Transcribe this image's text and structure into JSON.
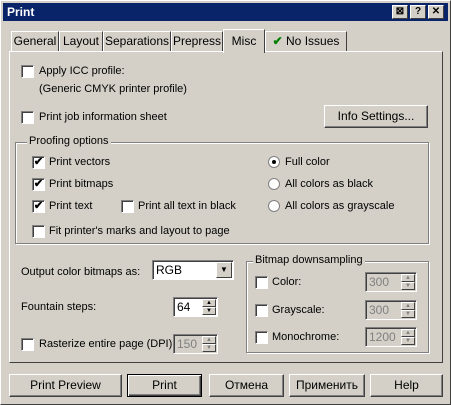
{
  "window": {
    "title": "Print"
  },
  "title_buttons": {
    "help": "?",
    "close": "✕"
  },
  "tabs": [
    {
      "label": "General"
    },
    {
      "label": "Layout"
    },
    {
      "label": "Separations"
    },
    {
      "label": "Prepress"
    },
    {
      "label": "Misc"
    },
    {
      "label": "No Issues"
    }
  ],
  "icc": {
    "label": "Apply ICC profile:",
    "profile": "(Generic CMYK printer profile)",
    "checked": false
  },
  "job_info": {
    "label": "Print job information sheet",
    "checked": false,
    "button": "Info Settings..."
  },
  "proofing": {
    "title": "Proofing options",
    "print_vectors": {
      "label": "Print vectors",
      "checked": true
    },
    "print_bitmaps": {
      "label": "Print bitmaps",
      "checked": true
    },
    "print_text": {
      "label": "Print text",
      "checked": true
    },
    "all_text_black": {
      "label": "Print all text in black",
      "checked": false
    },
    "fit_marks": {
      "label": "Fit printer's marks and layout to page",
      "checked": false
    },
    "color_modes": [
      {
        "label": "Full color",
        "selected": true
      },
      {
        "label": "All colors as black",
        "selected": false
      },
      {
        "label": "All colors as grayscale",
        "selected": false
      }
    ]
  },
  "output_bitmaps": {
    "label": "Output color bitmaps as:",
    "value": "RGB"
  },
  "fountain": {
    "label": "Fountain steps:",
    "value": "64"
  },
  "rasterize": {
    "label": "Rasterize entire page (DPI):",
    "value": "150",
    "checked": false
  },
  "downsampling": {
    "title": "Bitmap downsampling",
    "rows": [
      {
        "label": "Color:",
        "value": "300"
      },
      {
        "label": "Grayscale:",
        "value": "300"
      },
      {
        "label": "Monochrome:",
        "value": "1200"
      }
    ]
  },
  "buttons": {
    "preview": "Print Preview",
    "print": "Print",
    "cancel": "Отмена",
    "apply": "Применить",
    "help": "Help"
  },
  "check_glyph": "✔"
}
